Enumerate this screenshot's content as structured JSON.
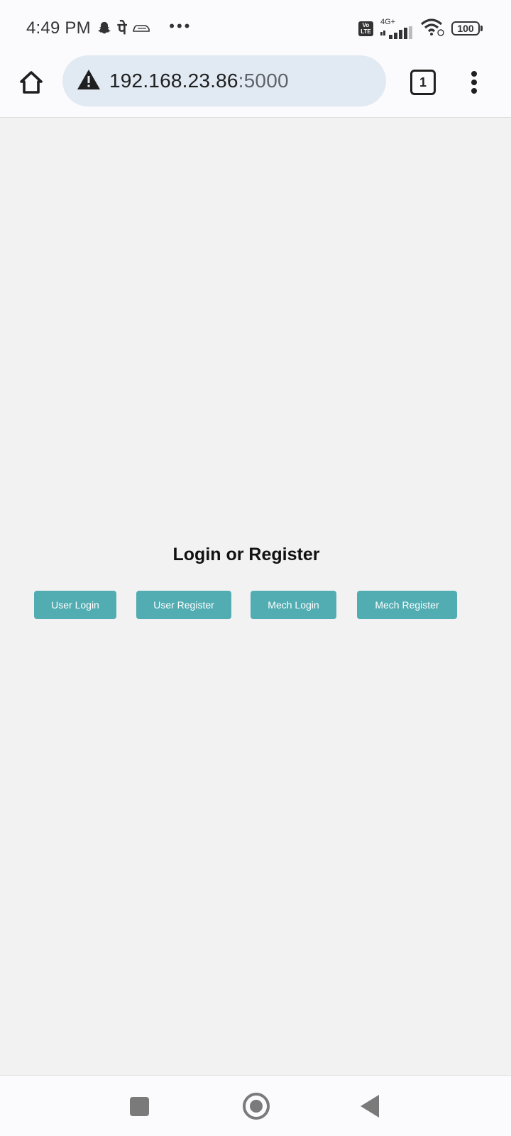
{
  "status_bar": {
    "time": "4:49 PM",
    "hindi_glyph": "पे",
    "more_dots": "•••",
    "volte_top": "Vo",
    "volte_bottom": "LTE",
    "network": "4G+",
    "battery": "100"
  },
  "browser": {
    "url_host": "192.168.23.86",
    "url_port": ":5000",
    "tab_count": "1"
  },
  "page": {
    "title": "Login or Register",
    "buttons": {
      "user_login": "User Login",
      "user_register": "User Register",
      "mech_login": "Mech Login",
      "mech_register": "Mech Register"
    },
    "button_color": "#52adb3"
  },
  "icons": {
    "home": "home-icon",
    "warning": "warning-icon",
    "tabs": "tabs-icon",
    "menu": "more-vert-icon",
    "nav_recents": "recents-icon",
    "nav_home": "nav-home-icon",
    "nav_back": "back-icon"
  }
}
